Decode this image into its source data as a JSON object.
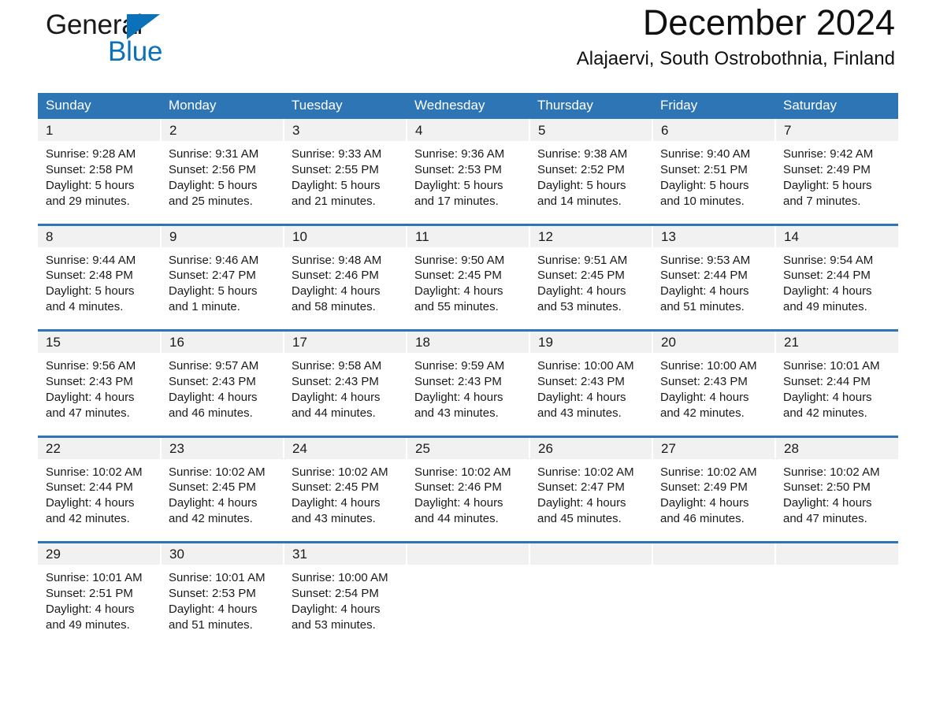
{
  "brand": {
    "word_one": "General",
    "word_two": "Blue",
    "triangle_icon": "triangle-icon",
    "accent_color": "#0b72b9"
  },
  "header": {
    "title": "December 2024",
    "subtitle": "Alajaervi, South Ostrobothnia, Finland"
  },
  "theme": {
    "header_blue": "#2e75b6",
    "daynum_band": "#f1f1f1",
    "text": "#1a1a1a"
  },
  "weekday_headers": [
    "Sunday",
    "Monday",
    "Tuesday",
    "Wednesday",
    "Thursday",
    "Friday",
    "Saturday"
  ],
  "weeks": [
    {
      "daynums": [
        "1",
        "2",
        "3",
        "4",
        "5",
        "6",
        "7"
      ],
      "cells": [
        {
          "sunrise": "Sunrise: 9:28 AM",
          "sunset": "Sunset: 2:58 PM",
          "daylight_1": "Daylight: 5 hours",
          "daylight_2": "and 29 minutes."
        },
        {
          "sunrise": "Sunrise: 9:31 AM",
          "sunset": "Sunset: 2:56 PM",
          "daylight_1": "Daylight: 5 hours",
          "daylight_2": "and 25 minutes."
        },
        {
          "sunrise": "Sunrise: 9:33 AM",
          "sunset": "Sunset: 2:55 PM",
          "daylight_1": "Daylight: 5 hours",
          "daylight_2": "and 21 minutes."
        },
        {
          "sunrise": "Sunrise: 9:36 AM",
          "sunset": "Sunset: 2:53 PM",
          "daylight_1": "Daylight: 5 hours",
          "daylight_2": "and 17 minutes."
        },
        {
          "sunrise": "Sunrise: 9:38 AM",
          "sunset": "Sunset: 2:52 PM",
          "daylight_1": "Daylight: 5 hours",
          "daylight_2": "and 14 minutes."
        },
        {
          "sunrise": "Sunrise: 9:40 AM",
          "sunset": "Sunset: 2:51 PM",
          "daylight_1": "Daylight: 5 hours",
          "daylight_2": "and 10 minutes."
        },
        {
          "sunrise": "Sunrise: 9:42 AM",
          "sunset": "Sunset: 2:49 PM",
          "daylight_1": "Daylight: 5 hours",
          "daylight_2": "and 7 minutes."
        }
      ]
    },
    {
      "daynums": [
        "8",
        "9",
        "10",
        "11",
        "12",
        "13",
        "14"
      ],
      "cells": [
        {
          "sunrise": "Sunrise: 9:44 AM",
          "sunset": "Sunset: 2:48 PM",
          "daylight_1": "Daylight: 5 hours",
          "daylight_2": "and 4 minutes."
        },
        {
          "sunrise": "Sunrise: 9:46 AM",
          "sunset": "Sunset: 2:47 PM",
          "daylight_1": "Daylight: 5 hours",
          "daylight_2": "and 1 minute."
        },
        {
          "sunrise": "Sunrise: 9:48 AM",
          "sunset": "Sunset: 2:46 PM",
          "daylight_1": "Daylight: 4 hours",
          "daylight_2": "and 58 minutes."
        },
        {
          "sunrise": "Sunrise: 9:50 AM",
          "sunset": "Sunset: 2:45 PM",
          "daylight_1": "Daylight: 4 hours",
          "daylight_2": "and 55 minutes."
        },
        {
          "sunrise": "Sunrise: 9:51 AM",
          "sunset": "Sunset: 2:45 PM",
          "daylight_1": "Daylight: 4 hours",
          "daylight_2": "and 53 minutes."
        },
        {
          "sunrise": "Sunrise: 9:53 AM",
          "sunset": "Sunset: 2:44 PM",
          "daylight_1": "Daylight: 4 hours",
          "daylight_2": "and 51 minutes."
        },
        {
          "sunrise": "Sunrise: 9:54 AM",
          "sunset": "Sunset: 2:44 PM",
          "daylight_1": "Daylight: 4 hours",
          "daylight_2": "and 49 minutes."
        }
      ]
    },
    {
      "daynums": [
        "15",
        "16",
        "17",
        "18",
        "19",
        "20",
        "21"
      ],
      "cells": [
        {
          "sunrise": "Sunrise: 9:56 AM",
          "sunset": "Sunset: 2:43 PM",
          "daylight_1": "Daylight: 4 hours",
          "daylight_2": "and 47 minutes."
        },
        {
          "sunrise": "Sunrise: 9:57 AM",
          "sunset": "Sunset: 2:43 PM",
          "daylight_1": "Daylight: 4 hours",
          "daylight_2": "and 46 minutes."
        },
        {
          "sunrise": "Sunrise: 9:58 AM",
          "sunset": "Sunset: 2:43 PM",
          "daylight_1": "Daylight: 4 hours",
          "daylight_2": "and 44 minutes."
        },
        {
          "sunrise": "Sunrise: 9:59 AM",
          "sunset": "Sunset: 2:43 PM",
          "daylight_1": "Daylight: 4 hours",
          "daylight_2": "and 43 minutes."
        },
        {
          "sunrise": "Sunrise: 10:00 AM",
          "sunset": "Sunset: 2:43 PM",
          "daylight_1": "Daylight: 4 hours",
          "daylight_2": "and 43 minutes."
        },
        {
          "sunrise": "Sunrise: 10:00 AM",
          "sunset": "Sunset: 2:43 PM",
          "daylight_1": "Daylight: 4 hours",
          "daylight_2": "and 42 minutes."
        },
        {
          "sunrise": "Sunrise: 10:01 AM",
          "sunset": "Sunset: 2:44 PM",
          "daylight_1": "Daylight: 4 hours",
          "daylight_2": "and 42 minutes."
        }
      ]
    },
    {
      "daynums": [
        "22",
        "23",
        "24",
        "25",
        "26",
        "27",
        "28"
      ],
      "cells": [
        {
          "sunrise": "Sunrise: 10:02 AM",
          "sunset": "Sunset: 2:44 PM",
          "daylight_1": "Daylight: 4 hours",
          "daylight_2": "and 42 minutes."
        },
        {
          "sunrise": "Sunrise: 10:02 AM",
          "sunset": "Sunset: 2:45 PM",
          "daylight_1": "Daylight: 4 hours",
          "daylight_2": "and 42 minutes."
        },
        {
          "sunrise": "Sunrise: 10:02 AM",
          "sunset": "Sunset: 2:45 PM",
          "daylight_1": "Daylight: 4 hours",
          "daylight_2": "and 43 minutes."
        },
        {
          "sunrise": "Sunrise: 10:02 AM",
          "sunset": "Sunset: 2:46 PM",
          "daylight_1": "Daylight: 4 hours",
          "daylight_2": "and 44 minutes."
        },
        {
          "sunrise": "Sunrise: 10:02 AM",
          "sunset": "Sunset: 2:47 PM",
          "daylight_1": "Daylight: 4 hours",
          "daylight_2": "and 45 minutes."
        },
        {
          "sunrise": "Sunrise: 10:02 AM",
          "sunset": "Sunset: 2:49 PM",
          "daylight_1": "Daylight: 4 hours",
          "daylight_2": "and 46 minutes."
        },
        {
          "sunrise": "Sunrise: 10:02 AM",
          "sunset": "Sunset: 2:50 PM",
          "daylight_1": "Daylight: 4 hours",
          "daylight_2": "and 47 minutes."
        }
      ]
    },
    {
      "daynums": [
        "29",
        "30",
        "31",
        "",
        "",
        "",
        ""
      ],
      "cells": [
        {
          "sunrise": "Sunrise: 10:01 AM",
          "sunset": "Sunset: 2:51 PM",
          "daylight_1": "Daylight: 4 hours",
          "daylight_2": "and 49 minutes."
        },
        {
          "sunrise": "Sunrise: 10:01 AM",
          "sunset": "Sunset: 2:53 PM",
          "daylight_1": "Daylight: 4 hours",
          "daylight_2": "and 51 minutes."
        },
        {
          "sunrise": "Sunrise: 10:00 AM",
          "sunset": "Sunset: 2:54 PM",
          "daylight_1": "Daylight: 4 hours",
          "daylight_2": "and 53 minutes."
        },
        {
          "sunrise": "",
          "sunset": "",
          "daylight_1": "",
          "daylight_2": ""
        },
        {
          "sunrise": "",
          "sunset": "",
          "daylight_1": "",
          "daylight_2": ""
        },
        {
          "sunrise": "",
          "sunset": "",
          "daylight_1": "",
          "daylight_2": ""
        },
        {
          "sunrise": "",
          "sunset": "",
          "daylight_1": "",
          "daylight_2": ""
        }
      ]
    }
  ]
}
